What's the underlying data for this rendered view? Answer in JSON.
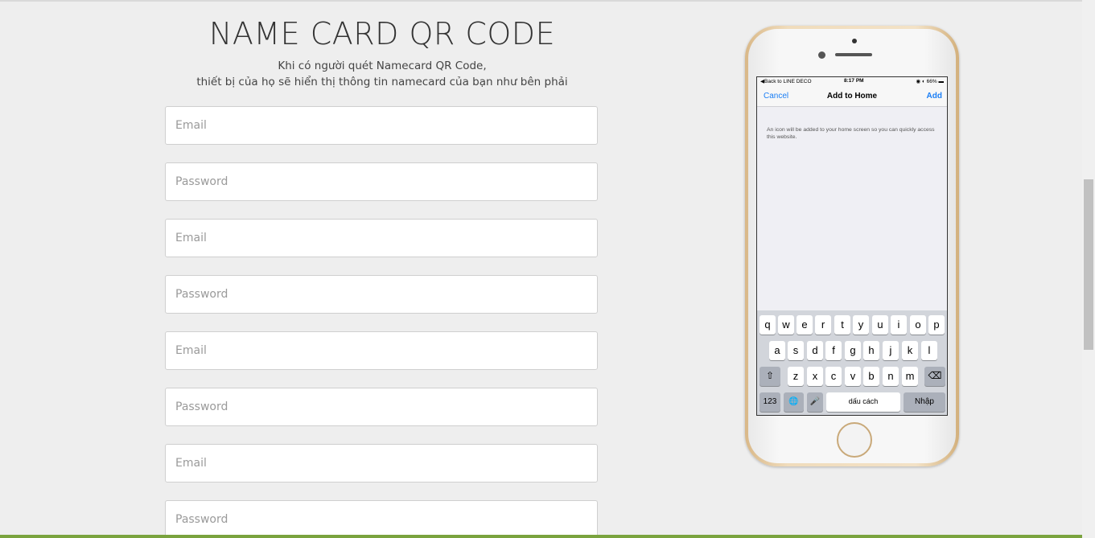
{
  "header": {
    "title": "NAME CARD QR CODE",
    "subtitle_line1": "Khi có người quét Namecard QR Code,",
    "subtitle_line2": "thiết bị của họ sẽ hiển thị thông tin namecard của bạn như bên phải"
  },
  "form": {
    "fields": [
      {
        "placeholder": "Email",
        "value": ""
      },
      {
        "placeholder": "Password",
        "value": ""
      },
      {
        "placeholder": "Email",
        "value": ""
      },
      {
        "placeholder": "Password",
        "value": ""
      },
      {
        "placeholder": "Email",
        "value": ""
      },
      {
        "placeholder": "Password",
        "value": ""
      },
      {
        "placeholder": "Email",
        "value": ""
      },
      {
        "placeholder": "Password",
        "value": ""
      }
    ]
  },
  "phone": {
    "status": {
      "back": "◀Back to LINE DECO",
      "time": "8:17 PM",
      "battery": "◉ ◐ 66% ▬"
    },
    "nav": {
      "cancel": "Cancel",
      "title": "Add to Home",
      "add": "Add"
    },
    "info": "An icon will be added to your home screen so you can quickly access this website.",
    "keyboard": {
      "row1": [
        "q",
        "w",
        "e",
        "r",
        "t",
        "y",
        "u",
        "i",
        "o",
        "p"
      ],
      "row2": [
        "a",
        "s",
        "d",
        "f",
        "g",
        "h",
        "j",
        "k",
        "l"
      ],
      "row3": [
        "z",
        "x",
        "c",
        "v",
        "b",
        "n",
        "m"
      ],
      "shift": "⇧",
      "backspace": "⌫",
      "num": "123",
      "globe": "🌐",
      "mic": "🎤",
      "space": "dấu cách",
      "enter": "Nhập"
    }
  },
  "colors": {
    "background": "#eeeeee",
    "accent": "#7aa33e",
    "ios_blue": "#1a7ef5"
  }
}
